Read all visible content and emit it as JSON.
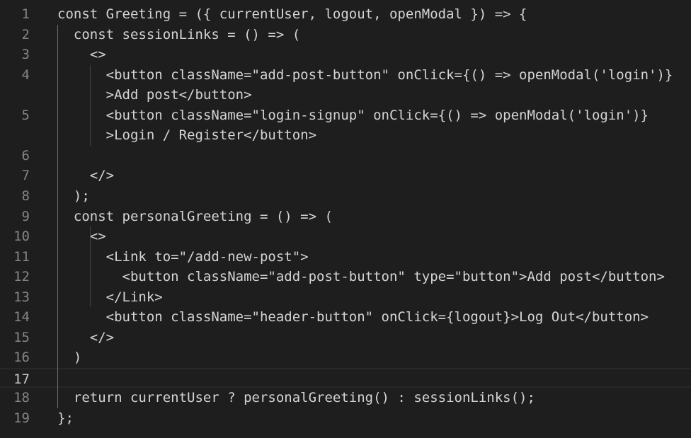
{
  "editor": {
    "active_line": "17",
    "rows": [
      {
        "num": "1",
        "text": "const Greeting = ({ currentUser, logout, openModal }) => {"
      },
      {
        "num": "2",
        "text": "  const sessionLinks = () => ("
      },
      {
        "num": "3",
        "text": "    <>"
      },
      {
        "num": "4",
        "text": "      <button className=\"add-post-button\" onClick={() => openModal('login')}"
      },
      {
        "num": "",
        "text": "      >Add post</button>"
      },
      {
        "num": "5",
        "text": "      <button className=\"login-signup\" onClick={() => openModal('login')}"
      },
      {
        "num": "",
        "text": "      >Login / Register</button>"
      },
      {
        "num": "6",
        "text": ""
      },
      {
        "num": "7",
        "text": "    </>"
      },
      {
        "num": "8",
        "text": "  );"
      },
      {
        "num": "9",
        "text": "  const personalGreeting = () => ("
      },
      {
        "num": "10",
        "text": "    <>"
      },
      {
        "num": "11",
        "text": "      <Link to=\"/add-new-post\">"
      },
      {
        "num": "12",
        "text": "        <button className=\"add-post-button\" type=\"button\">Add post</button>"
      },
      {
        "num": "13",
        "text": "      </Link>"
      },
      {
        "num": "14",
        "text": "      <button className=\"header-button\" onClick={logout}>Log Out</button>"
      },
      {
        "num": "15",
        "text": "    </>"
      },
      {
        "num": "16",
        "text": "  )"
      },
      {
        "num": "17",
        "text": ""
      },
      {
        "num": "18",
        "text": "  return currentUser ? personalGreeting() : sessionLinks();"
      },
      {
        "num": "19",
        "text": "};"
      }
    ]
  }
}
